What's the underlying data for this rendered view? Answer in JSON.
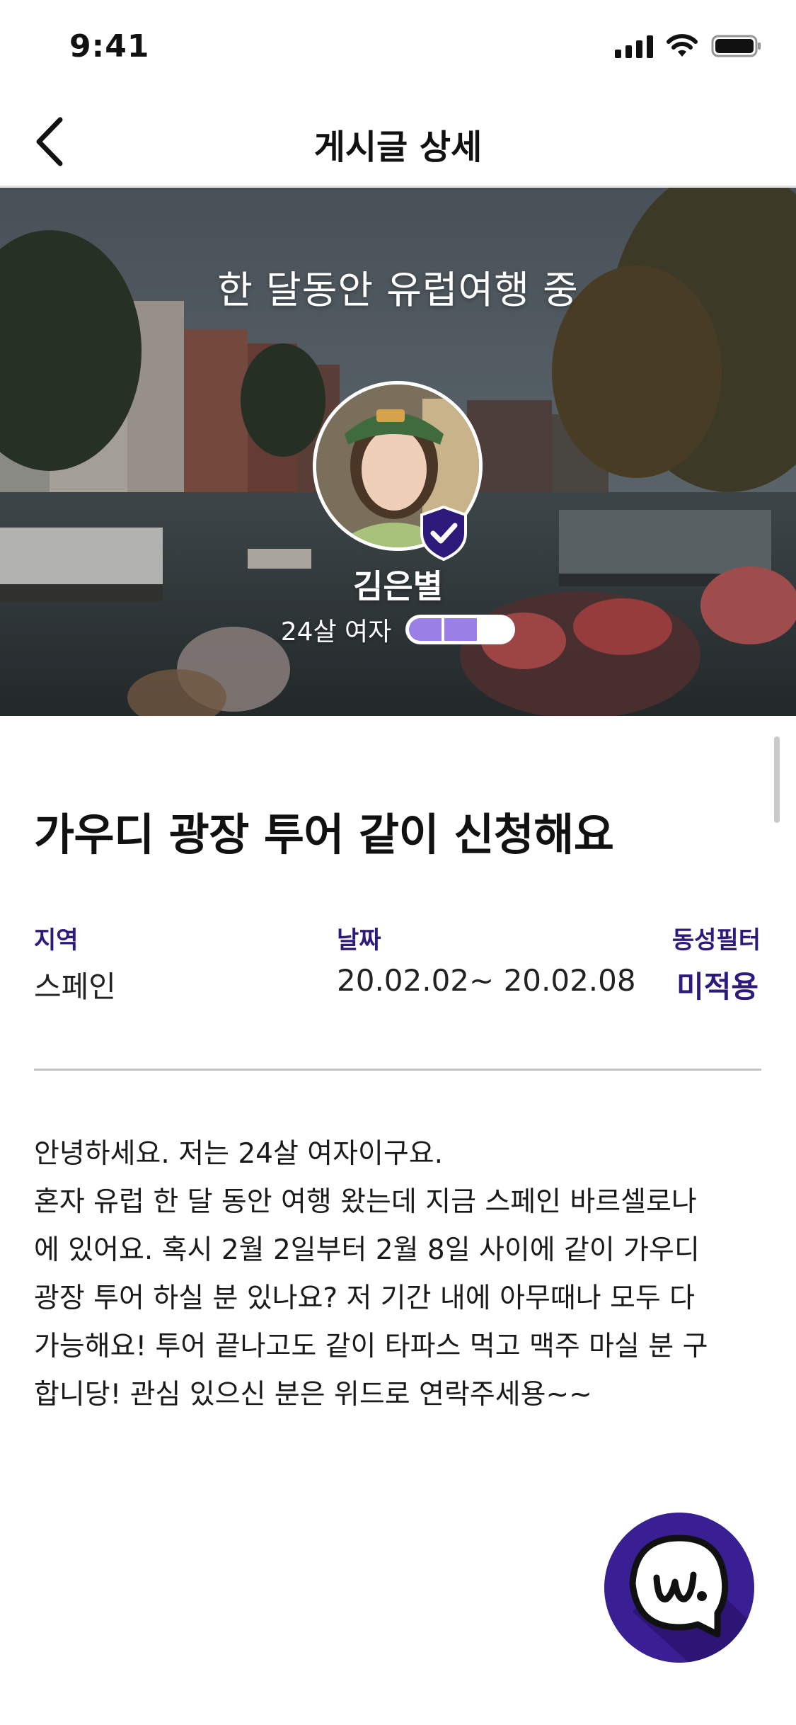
{
  "status_bar": {
    "time": "9:41",
    "icons": [
      "cellular-signal-icon",
      "wifi-icon",
      "battery-icon"
    ]
  },
  "header": {
    "back_icon": "chevron-left-icon",
    "title": "게시글 상세"
  },
  "hero": {
    "tagline": "한 달동안 유럽여행 중",
    "profile": {
      "name": "김은별",
      "meta": "24살 여자",
      "level_filled": 2,
      "level_total": 3,
      "badge_icon": "shield-check-icon"
    }
  },
  "post": {
    "title": "가우디 광장 투어 같이 신청해요",
    "info": {
      "region_label": "지역",
      "region_value": "스페인",
      "date_label": "날짜",
      "date_value": "20.02.02~ 20.02.08",
      "filter_label": "동성필터",
      "filter_value": "미적용"
    },
    "body": "안녕하세요. 저는 24살 여자이구요.\n혼자 유럽 한 달 동안 여행 왔는데 지금 스페인 바르셀로나\n에 있어요. 혹시 2월 2일부터 2월 8일 사이에 같이 가우디\n광장 투어 하실 분 있나요? 저 기간 내에 아무때나 모두 다\n가능해요! 투어 끝나고도 같이 타파스 먹고 맥주 마실 분 구\n합니당! 관심 있으신 분은 위드로 연락주세용~~"
  },
  "fab": {
    "icon": "with-logo-chat-icon"
  },
  "colors": {
    "accent": "#2d1a7a",
    "fab_bg": "#3a1e94",
    "level_fill": "#9a7fe6"
  }
}
